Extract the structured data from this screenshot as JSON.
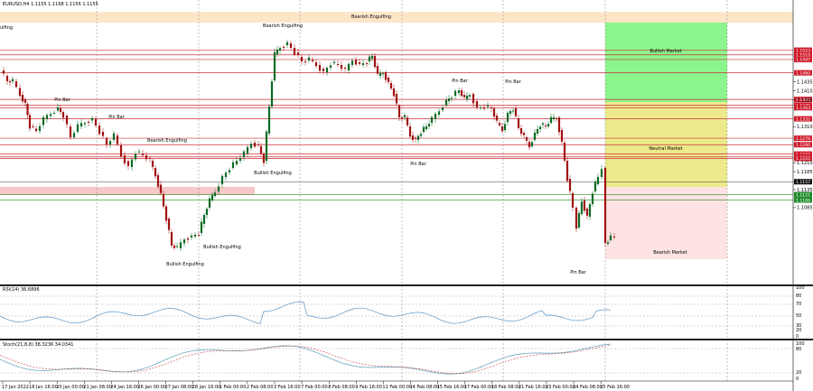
{
  "header": {
    "symbol_info": "EURUSD,H4  1.1155 1.1168 1.1156 1.1155",
    "current_price": "1.1157"
  },
  "left_edge_label": "ulfing",
  "zones": [
    {
      "label": "Bullish Market",
      "color": "#8df58d"
    },
    {
      "label": "Neutral Market",
      "color": "#ecea8a"
    },
    {
      "label": "Bearish Market",
      "color": "#fde3e3"
    }
  ],
  "price_labels": [
    {
      "text": "1.1523",
      "kind": "red"
    },
    {
      "text": "1.1510",
      "kind": "red"
    },
    {
      "text": "1.1497",
      "kind": "red"
    },
    {
      "text": "1.1460",
      "kind": "red"
    },
    {
      "text": "1.1435",
      "kind": "axis"
    },
    {
      "text": "1.1410",
      "kind": "axis"
    },
    {
      "text": "1.1386",
      "kind": "red"
    },
    {
      "text": "1.1385",
      "kind": "axis"
    },
    {
      "text": "1.1370",
      "kind": "red"
    },
    {
      "text": "1.1363",
      "kind": "red"
    },
    {
      "text": "1.1332",
      "kind": "red"
    },
    {
      "text": "1.1310",
      "kind": "axis"
    },
    {
      "text": "1.1278",
      "kind": "red"
    },
    {
      "text": "1.1260",
      "kind": "red"
    },
    {
      "text": "1.1234",
      "kind": "red"
    },
    {
      "text": "1.1226",
      "kind": "red"
    },
    {
      "text": "1.1222",
      "kind": "red"
    },
    {
      "text": "1.1210",
      "kind": "axis"
    },
    {
      "text": "1.1185",
      "kind": "axis"
    },
    {
      "text": "1.1157",
      "kind": "current"
    },
    {
      "text": "1.1135",
      "kind": "axis"
    },
    {
      "text": "1.1121",
      "kind": "green"
    },
    {
      "text": "1.1106",
      "kind": "green"
    },
    {
      "text": "1.1085",
      "kind": "axis"
    }
  ],
  "annotations": [
    "Bearish Engulfing",
    "Bearish Engulfing",
    "Pin Bar",
    "Pin Bar",
    "Bearish Engulfing",
    "Bullish Engulfing",
    "Bullish Engulfing",
    "Bullish Engulfing",
    "Pin Bar",
    "Pin Bar",
    "Pin Bar",
    "Pin Bar"
  ],
  "rsi": {
    "label": "RSI(14) 36.6896",
    "levels": [
      "100",
      "80",
      "70",
      "50",
      "30",
      "20",
      "0"
    ]
  },
  "stoch": {
    "label": "Stoch(21,8,8) 38.3236 34.0341",
    "levels": [
      "100",
      "80",
      "20",
      "0"
    ]
  },
  "dates": [
    "17 Jan 2022",
    "18 Jan 16:00",
    "20 Jan 00:00",
    "21 Jan 08:00",
    "24 Jan 16:00",
    "26 Jan 00:00",
    "27 Jan 08:00",
    "28 Jan 16:00",
    "1 Feb 00:00",
    "2 Feb 08:00",
    "3 Feb 16:00",
    "7 Feb 00:00",
    "8 Feb 08:00",
    "9 Feb 16:00",
    "11 Feb 00:00",
    "14 Feb 08:00",
    "15 Feb 16:00",
    "17 Feb 00:00",
    "18 Feb 08:00",
    "21 Feb 16:00",
    "23 Feb 00:00",
    "24 Feb 08:00",
    "25 Feb 16:00"
  ],
  "colors": {
    "bull": "#0a6b24",
    "bear": "#a01010",
    "red_line": "#c8303a",
    "green_line": "#2a8c2a",
    "rsi_line": "#5a95c8",
    "grid": "#777777"
  }
}
